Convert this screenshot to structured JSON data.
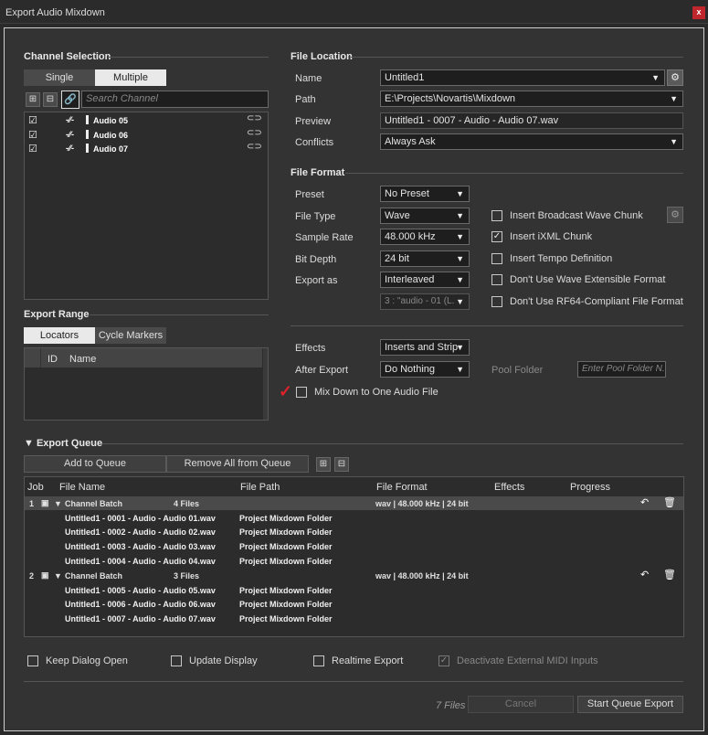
{
  "window": {
    "title": "Export Audio Mixdown",
    "close": "x"
  },
  "channel_selection": {
    "title": "Channel Selection",
    "single": "Single",
    "multiple": "Multiple",
    "search_placeholder": "Search Channel",
    "channels": [
      {
        "name": "Audio 05",
        "checked": "☑"
      },
      {
        "name": "Audio 06",
        "checked": "☑"
      },
      {
        "name": "Audio 07",
        "checked": "☑"
      }
    ]
  },
  "export_range": {
    "title": "Export Range",
    "locators": "Locators",
    "cycle_markers": "Cycle Markers",
    "col_id": "ID",
    "col_name": "Name"
  },
  "file_location": {
    "title": "File Location",
    "name_label": "Name",
    "name_value": "Untitled1",
    "path_label": "Path",
    "path_value": "E:\\Projects\\Novartis\\Mixdown",
    "preview_label": "Preview",
    "preview_value": "Untitled1 - 0007 - Audio - Audio 07.wav",
    "conflicts_label": "Conflicts",
    "conflicts_value": "Always Ask"
  },
  "file_format": {
    "title": "File Format",
    "preset_label": "Preset",
    "preset_value": "No Preset",
    "filetype_label": "File Type",
    "filetype_value": "Wave",
    "samplerate_label": "Sample Rate",
    "samplerate_value": "48.000 kHz",
    "bitdepth_label": "Bit Depth",
    "bitdepth_value": "24 bit",
    "exportas_label": "Export as",
    "exportas_value": "Interleaved",
    "channel_value": "3 : \"audio - 01 (L.",
    "broadcast": "Insert Broadcast Wave Chunk",
    "ixml": "Insert iXML Chunk",
    "tempo": "Insert Tempo Definition",
    "wave_ext": "Don't Use Wave Extensible Format",
    "rf64": "Don't Use RF64-Compliant File Format",
    "effects_label": "Effects",
    "effects_value": "Inserts and Strip",
    "after_label": "After Export",
    "after_value": "Do Nothing",
    "pool_label": "Pool Folder",
    "pool_placeholder": "Enter Pool Folder N.",
    "mixdown": "Mix Down to One Audio File"
  },
  "queue": {
    "title": "Export Queue",
    "add": "Add to Queue",
    "remove": "Remove All from Queue",
    "headers": {
      "job": "Job",
      "file_name": "File Name",
      "file_path": "File Path",
      "file_format": "File Format",
      "effects": "Effects",
      "progress": "Progress"
    },
    "batches": [
      {
        "job": "1",
        "name": "Channel Batch",
        "files": "4 Files",
        "format": "wav | 48.000 kHz | 24 bit",
        "items": [
          {
            "name": "Untitled1 - 0001 - Audio - Audio 01.wav",
            "path": "Project Mixdown Folder"
          },
          {
            "name": "Untitled1 - 0002 - Audio - Audio 02.wav",
            "path": "Project Mixdown Folder"
          },
          {
            "name": "Untitled1 - 0003 - Audio - Audio 03.wav",
            "path": "Project Mixdown Folder"
          },
          {
            "name": "Untitled1 - 0004 - Audio - Audio 04.wav",
            "path": "Project Mixdown Folder"
          }
        ]
      },
      {
        "job": "2",
        "name": "Channel Batch",
        "files": "3 Files",
        "format": "wav | 48.000 kHz | 24 bit",
        "items": [
          {
            "name": "Untitled1 - 0005 - Audio - Audio 05.wav",
            "path": "Project Mixdown Folder"
          },
          {
            "name": "Untitled1 - 0006 - Audio - Audio 06.wav",
            "path": "Project Mixdown Folder"
          },
          {
            "name": "Untitled1 - 0007 - Audio - Audio 07.wav",
            "path": "Project Mixdown Folder"
          }
        ]
      }
    ]
  },
  "footer": {
    "keep_open": "Keep Dialog Open",
    "update_display": "Update Display",
    "realtime": "Realtime Export",
    "deactivate_midi": "Deactivate External MIDI Inputs",
    "files_count": "7 Files",
    "cancel": "Cancel",
    "start": "Start Queue Export"
  },
  "colors": {
    "accent_red": "#e0202a"
  }
}
